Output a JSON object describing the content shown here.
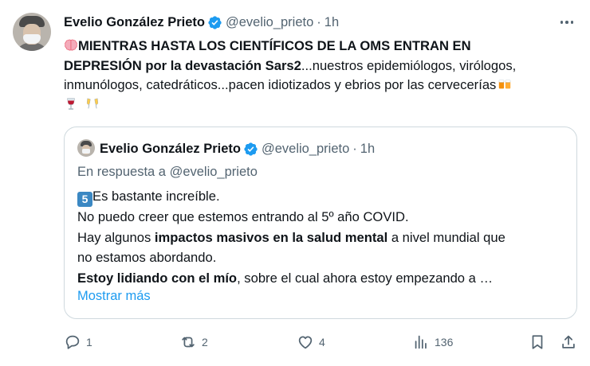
{
  "author": {
    "name": "Evelio González Prieto",
    "handle": "@evelio_prieto",
    "time": "1h",
    "separator": "·"
  },
  "post": {
    "line1_bold": "MIENTRAS HASTA LOS CIENTÍFICOS DE LA OMS ENTRAN EN",
    "line2_bold": "DEPRESIÓN por la devastación Sars2",
    "line2_rest": "...nuestros epidemiólogos, virólogos,",
    "line3": "inmunólogos, catedráticos...pacen idiotizados y ebrios por las cervecerías",
    "emojis": [
      "brain-emoji",
      "beer-mugs-emoji",
      "wine-glass-emoji",
      "champagne-emoji"
    ]
  },
  "quote": {
    "name": "Evelio González Prieto",
    "handle": "@evelio_prieto",
    "time": "1h",
    "separator": "·",
    "reply_to": "En respuesta a @evelio_prieto",
    "keycap": "5",
    "line1": "Es bastante increíble.",
    "line2": "No puedo creer que estemos entrando al 5º año COVID.",
    "line3_pre": "Hay algunos ",
    "line3_bold": "impactos masivos en la salud mental",
    "line3_post": " a nivel mundial que",
    "line4": "no estamos abordando.",
    "line5_bold": "Estoy lidiando con el mío",
    "line5_rest": ", sobre el cual ahora estoy empezando a …",
    "show_more": "Mostrar más"
  },
  "actions": {
    "replies": "1",
    "reposts": "2",
    "likes": "4",
    "views": "136"
  },
  "colors": {
    "text": "#0f1419",
    "secondary": "#536471",
    "link": "#1d9bf0",
    "border": "#cfd9de",
    "verified": "#1d9bf0"
  }
}
